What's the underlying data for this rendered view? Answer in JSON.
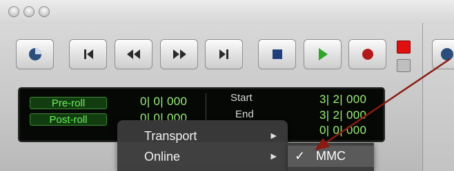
{
  "toolbar": {
    "buttons": [
      {
        "name": "wait-for-note-button",
        "icon": "wait-for-note-icon"
      },
      {
        "name": "return-to-zero-button",
        "icon": "return-to-zero-icon"
      },
      {
        "name": "rewind-button",
        "icon": "rewind-icon"
      },
      {
        "name": "fast-forward-button",
        "icon": "fast-forward-icon"
      },
      {
        "name": "go-to-end-button",
        "icon": "go-to-end-icon"
      },
      {
        "name": "stop-button",
        "icon": "stop-icon"
      },
      {
        "name": "play-button",
        "icon": "play-icon"
      },
      {
        "name": "record-button",
        "icon": "record-icon"
      }
    ],
    "colors": {
      "stop": "#1f3f7f",
      "play": "#2fa62a",
      "record": "#b51a1a",
      "rec_led_on": "#e01010",
      "rec_led_off": "#bfbfbf"
    }
  },
  "counter": {
    "preroll_label": "Pre-roll",
    "postroll_label": "Post-roll",
    "preroll_value": "0| 0| 000",
    "postroll_value": "0| 0| 000",
    "start_label": "Start",
    "end_label": "End",
    "start_value": "3| 2| 000",
    "end_value": "3| 2| 000",
    "length_value": "0| 0| 000",
    "colors": {
      "display_bg": "#050805",
      "digits": "#9cf07b",
      "pill_text": "#6cf25b"
    }
  },
  "menu": {
    "items": [
      {
        "label": "Transport",
        "has_submenu": true
      },
      {
        "label": "Online",
        "has_submenu": true
      }
    ],
    "submenu": {
      "items": [
        {
          "label": "MMC",
          "checked": true,
          "check": "✓"
        }
      ]
    }
  },
  "annotation": {
    "arrow_color": "#8b1a12"
  }
}
